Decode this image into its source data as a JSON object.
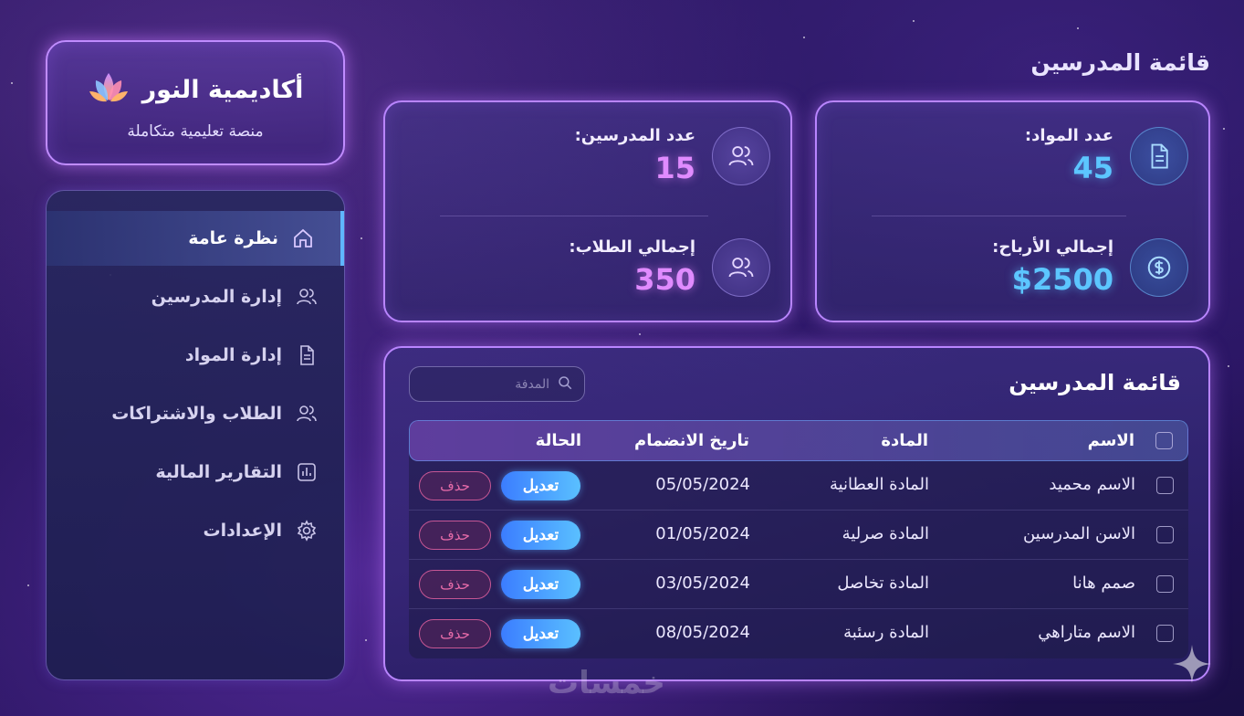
{
  "brand": {
    "title": "أكاديمية النور",
    "subtitle": "منصة تعليمية متكاملة"
  },
  "sidebar": {
    "items": [
      {
        "label": "نظرة عامة",
        "icon": "home-icon",
        "active": true
      },
      {
        "label": "إدارة المدرسين",
        "icon": "users-icon",
        "active": false
      },
      {
        "label": "إدارة المواد",
        "icon": "document-icon",
        "active": false
      },
      {
        "label": "الطلاب والاشتراكات",
        "icon": "users-icon",
        "active": false
      },
      {
        "label": "التقارير المالية",
        "icon": "bar-chart-icon",
        "active": false
      },
      {
        "label": "الإعدادات",
        "icon": "gear-icon",
        "active": false
      }
    ]
  },
  "page_title": "قائمة المدرسين",
  "stats": {
    "teachers": {
      "label": "عدد المدرسين:",
      "value": "15"
    },
    "students": {
      "label": "إجمالي الطلاب:",
      "value": "350"
    },
    "subjects": {
      "label": "عدد المواد:",
      "value": "45"
    },
    "profits": {
      "label": "إجمالي الأرباح:",
      "value": "$2500"
    }
  },
  "table": {
    "title": "قائمة المدرسين",
    "search_placeholder": "المدفة",
    "columns": {
      "name": "الاسم",
      "subject": "المادة",
      "joined": "تاريخ الانضمام",
      "status": "الحالة"
    },
    "rows": [
      {
        "name": "الاسم محميد",
        "subject": "المادة العطانية",
        "joined": "05/05/2024",
        "edit": "تعديل",
        "delete": "حذف"
      },
      {
        "name": "الاسن المدرسين",
        "subject": "المادة صرلية",
        "joined": "01/05/2024",
        "edit": "تعديل",
        "delete": "حذف"
      },
      {
        "name": "صمم هانا",
        "subject": "المادة تخاصل",
        "joined": "03/05/2024",
        "edit": "تعديل",
        "delete": "حذف"
      },
      {
        "name": "الاسم متاراهي",
        "subject": "المادة رسئبة",
        "joined": "08/05/2024",
        "edit": "تعديل",
        "delete": "حذف"
      }
    ]
  },
  "watermark": "خمسات",
  "colors": {
    "accent_pink": "#e08bff",
    "accent_cyan": "#5cc6ff",
    "edit_button": "#3b7dff",
    "delete_button": "#e56aa8"
  }
}
